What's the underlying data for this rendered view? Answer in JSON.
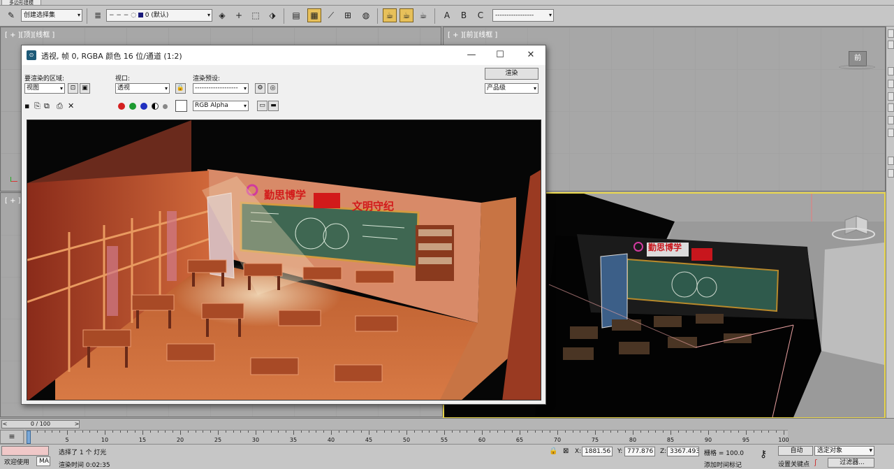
{
  "ribbon": {
    "tab": "多边形建模"
  },
  "toolbar": {
    "selection_set": "创建选择集",
    "layer_combo": "0 (默认)",
    "named_sel_combo": "-----------------"
  },
  "viewports": {
    "top": "[ + ][顶][线框 ]",
    "front": "[ + ][前][线框 ]",
    "left": "[ + ][左][线框 ]",
    "viewcube_front": "前"
  },
  "render_window": {
    "title": "透视, 帧 0, RGBA 颜色 16 位/通道 (1:2)",
    "area_label": "要渲染的区域:",
    "area_value": "视图",
    "viewport_label": "视口:",
    "viewport_value": "透视",
    "preset_label": "渲染预设:",
    "preset_value": "-------------------",
    "render_button": "渲染",
    "quality_value": "产品级",
    "channel_value": "RGB Alpha",
    "scene": {
      "banner_left": "勤思博学",
      "banner_right": "文明守纪"
    }
  },
  "viewport_scene": {
    "banner": "勤思博学"
  },
  "timeline": {
    "frame_slider": "0 / 100",
    "ticks": [
      "0",
      "5",
      "10",
      "15",
      "20",
      "25",
      "30",
      "35",
      "40",
      "45",
      "50",
      "55",
      "60",
      "65",
      "70",
      "75",
      "80",
      "85",
      "90",
      "95",
      "100"
    ]
  },
  "status": {
    "welcome": "欢迎使用",
    "maxscript": "MA:",
    "selected": "选择了 1 个 灯光",
    "render_time": "渲染时间 0:02:35",
    "x_label": "X:",
    "x_value": "1881.56",
    "y_label": "Y:",
    "y_value": "777.876",
    "z_label": "Z:",
    "z_value": "3367.493",
    "grid": "栅格 = 100.0",
    "add_time_tag": "添加时间标记",
    "auto_key": "自动",
    "set_key": "设置关键点",
    "selected_object": "选定对象",
    "filters": "过滤器..."
  }
}
